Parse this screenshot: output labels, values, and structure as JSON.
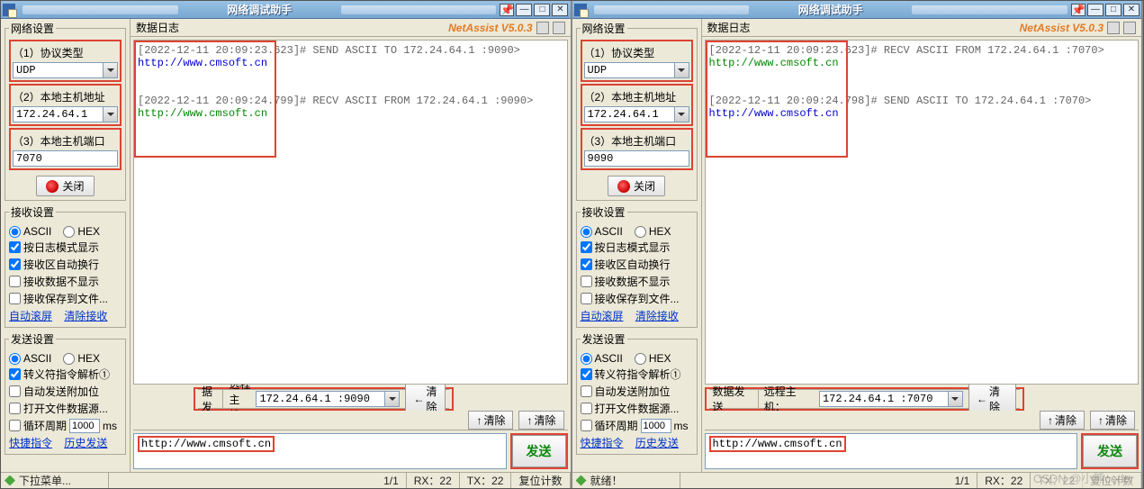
{
  "app_title": "网络调试助手",
  "version_label": "NetAssist V5.0.3",
  "sidebar": {
    "group_net": "网络设置",
    "f1": {
      "label": "（1）协议类型",
      "value": "UDP"
    },
    "f2": {
      "label": "（2）本地主机地址"
    },
    "f3": {
      "label": "（3）本地主机端口"
    },
    "close_label": "关闭",
    "group_recv": "接收设置",
    "radio_ascii": "ASCII",
    "radio_hex": "HEX",
    "recv_chk1": "按日志模式显示",
    "recv_chk2": "接收区自动换行",
    "recv_chk3": "接收数据不显示",
    "recv_chk4": "接收保存到文件...",
    "link_autoscroll": "自动滚屏",
    "link_clearrecv": "清除接收",
    "group_send": "发送设置",
    "send_chk1": "转义符指令解析①",
    "send_chk2": "自动发送附加位",
    "send_chk3": "打开文件数据源...",
    "period_lbl": "循环周期",
    "period_val": "1000",
    "period_unit": "ms",
    "link_quick": "快捷指令",
    "link_hist": "历史发送"
  },
  "main": {
    "log_label": "数据日志",
    "send_label": "数据发送",
    "remote_label": "远程主机：",
    "clear_btn": "清除",
    "send_btn": "发送",
    "send_value": "http://www.cmsoft.cn"
  },
  "status": {
    "dropdown": "下拉菜单...",
    "ready": "就绪！",
    "page": "1/1",
    "rx": "RX：22",
    "tx": "TX：22",
    "reset": "复位计数"
  },
  "left": {
    "host": "172.24.64.1",
    "port": "7070",
    "remote": "172.24.64.1 :9090",
    "log": {
      "l1a": "[2022-12-11 20:09:23.623]",
      "l1b": "# SEND ASCII TO 172.24.64.1 :9090>",
      "l2": "http://www.cmsoft.cn",
      "l3a": "[2022-12-11 20:09:24.799]",
      "l3b": "# RECV ASCII FROM 172.24.64.1 :9090>",
      "l4": "http://www.cmsoft.cn"
    }
  },
  "right": {
    "host": "172.24.64.1",
    "port": "9090",
    "remote": "172.24.64.1 :7070",
    "log": {
      "l1a": "[2022-12-11 20:09:23.623]",
      "l1b": "# RECV ASCII FROM 172.24.64.1 :7070>",
      "l2": "http://www.cmsoft.cn",
      "l3a": "[2022-12-11 20:09:24.798]",
      "l3b": "# SEND ASCII TO 172.24.64.1 :7070>",
      "l4": "http://www.cmsoft.cn"
    }
  },
  "watermark": "CSDN @小熊coder"
}
